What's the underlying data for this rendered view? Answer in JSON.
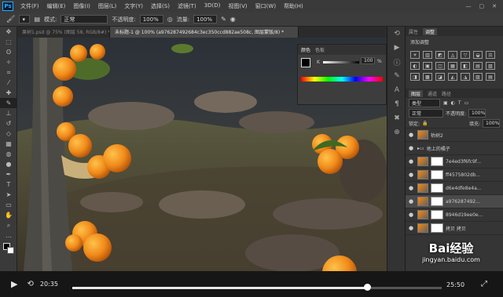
{
  "menu": {
    "logo": "Ps",
    "items": [
      "文件(F)",
      "编辑(E)",
      "图像(I)",
      "图层(L)",
      "文字(Y)",
      "选择(S)",
      "滤镜(T)",
      "3D(D)",
      "视图(V)",
      "窗口(W)",
      "帮助(H)"
    ]
  },
  "options": {
    "mode_label": "模式:",
    "mode_value": "正常",
    "opacity_label": "不透明度:",
    "opacity_value": "100%",
    "flow_label": "流量:",
    "flow_value": "100%"
  },
  "tabs": [
    {
      "label": "果树1.psd @ 75% (图层 58, RGB/8#) *",
      "active": false
    },
    {
      "label": "未标题-1 @ 100% (a976287492684c3ec350ccd882ae508c, 图层蒙版/8) *",
      "active": true
    }
  ],
  "color_panel": {
    "tab1": "颜色",
    "tab2": "色板",
    "slider_label": "K",
    "value": "100",
    "unit": "%"
  },
  "right_panel": {
    "tabs": [
      "属性",
      "调整"
    ],
    "adjust_title": "添加调整",
    "adj_icons": [
      "☀",
      "▥",
      "◩",
      "◬",
      "▽",
      "◒",
      "⚖",
      "◐",
      "▣",
      "◫",
      "▦",
      "◧",
      "▤",
      "▧",
      "◨",
      "▩",
      "◪",
      "◭",
      "◮",
      "▨",
      "▤"
    ],
    "layer_tabs": [
      "图层",
      "通道",
      "路径"
    ],
    "kind_label": "类型",
    "blend_mode": "正常",
    "opacity_label": "不透明度:",
    "opacity_value": "100%",
    "lock_label": "锁定:",
    "fill_label": "填充:",
    "fill_value": "100%",
    "layers": [
      {
        "name": "枯树2",
        "type": "layer",
        "selected": false
      },
      {
        "name": "地上的橘子",
        "type": "group",
        "selected": false
      },
      {
        "name": "7e4ed3f6fc9f...",
        "type": "masked",
        "selected": false
      },
      {
        "name": "ff4575802db...",
        "type": "masked",
        "selected": false
      },
      {
        "name": "d6e4dfe8e4a...",
        "type": "masked",
        "selected": false
      },
      {
        "name": "a976287492...",
        "type": "masked",
        "selected": true
      },
      {
        "name": "8946d19ee0e...",
        "type": "masked",
        "selected": false
      },
      {
        "name": "拷贝 拷贝",
        "type": "masked",
        "selected": false
      }
    ]
  },
  "video": {
    "current_time": "20:35",
    "total_time": "25:50",
    "progress": 0.797,
    "watermark": "Bai经验",
    "watermark_url": "jingyan.baidu.com"
  },
  "colors": {
    "accent": "#31a8ff",
    "orange": "#f08a1a"
  }
}
